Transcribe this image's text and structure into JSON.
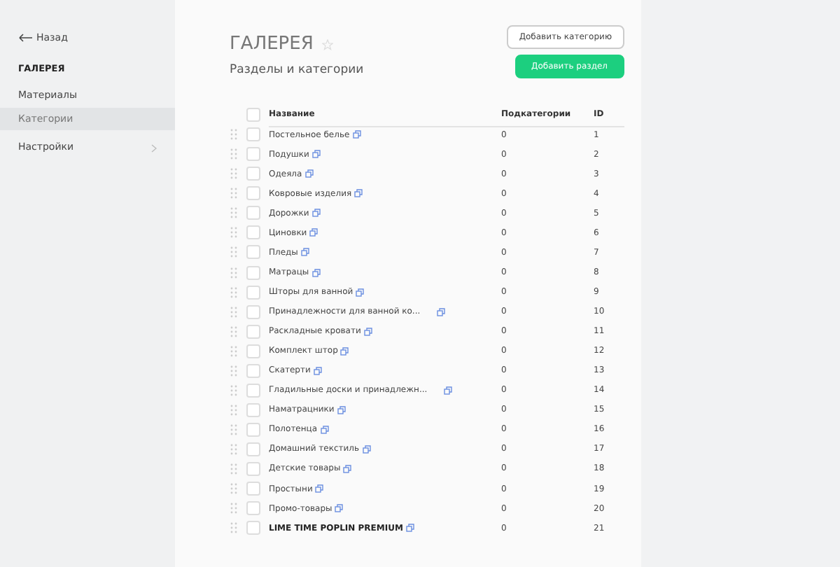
{
  "sidebar": {
    "back": "Назад",
    "section": "ГАЛЕРЕЯ",
    "items": [
      {
        "label": "Материалы",
        "selected": false,
        "has_submenu": false
      },
      {
        "label": "Категории",
        "selected": true,
        "has_submenu": false
      },
      {
        "label": "Настройки",
        "selected": false,
        "has_submenu": true
      }
    ]
  },
  "header": {
    "title": "ГАЛЕРЕЯ",
    "starred": false,
    "subtitle": "Разделы и категории",
    "buttons": [
      {
        "label": "Добавить категорию",
        "kind": "outline"
      },
      {
        "label": "Добавить раздел",
        "kind": "primary"
      }
    ]
  },
  "table": {
    "columns": [
      "Название",
      "Подкатегории",
      "ID"
    ],
    "header_checked": false,
    "rows": [
      {
        "name": "Постельное белье",
        "subcategories": "0",
        "id": "1",
        "checked": false,
        "bold": false
      },
      {
        "name": "Подушки",
        "subcategories": "0",
        "id": "2",
        "checked": false,
        "bold": false
      },
      {
        "name": "Одеяла",
        "subcategories": "0",
        "id": "3",
        "checked": false,
        "bold": false
      },
      {
        "name": "Ковровые изделия",
        "subcategories": "0",
        "id": "4",
        "checked": false,
        "bold": false
      },
      {
        "name": "Дорожки",
        "subcategories": "0",
        "id": "5",
        "checked": false,
        "bold": false
      },
      {
        "name": "Циновки",
        "subcategories": "0",
        "id": "6",
        "checked": false,
        "bold": false
      },
      {
        "name": "Пледы",
        "subcategories": "0",
        "id": "7",
        "checked": false,
        "bold": false
      },
      {
        "name": "Матрацы",
        "subcategories": "0",
        "id": "8",
        "checked": false,
        "bold": false
      },
      {
        "name": "Шторы для ванной",
        "subcategories": "0",
        "id": "9",
        "checked": false,
        "bold": false
      },
      {
        "name": "Принадлежности для ванной ко...",
        "subcategories": "0",
        "id": "10",
        "checked": false,
        "bold": false
      },
      {
        "name": "Раскладные кровати",
        "subcategories": "0",
        "id": "11",
        "checked": false,
        "bold": false
      },
      {
        "name": "Комплект штор",
        "subcategories": "0",
        "id": "12",
        "checked": false,
        "bold": false
      },
      {
        "name": "Скатерти",
        "subcategories": "0",
        "id": "13",
        "checked": false,
        "bold": false
      },
      {
        "name": "Гладильные доски и принадлежн...",
        "subcategories": "0",
        "id": "14",
        "checked": false,
        "bold": false
      },
      {
        "name": "Наматрацники",
        "subcategories": "0",
        "id": "15",
        "checked": false,
        "bold": false
      },
      {
        "name": "Полотенца",
        "subcategories": "0",
        "id": "16",
        "checked": false,
        "bold": false
      },
      {
        "name": "Домашний текстиль",
        "subcategories": "0",
        "id": "17",
        "checked": false,
        "bold": false
      },
      {
        "name": "Детские товары",
        "subcategories": "0",
        "id": "18",
        "checked": false,
        "bold": false
      },
      {
        "name": "Простыни",
        "subcategories": "0",
        "id": "19",
        "checked": false,
        "bold": false
      },
      {
        "name": "Промо-товары",
        "subcategories": "0",
        "id": "20",
        "checked": false,
        "bold": false
      },
      {
        "name": "LIME TIME POPLIN PREMIUM",
        "subcategories": "0",
        "id": "21",
        "checked": false,
        "bold": true
      }
    ]
  }
}
